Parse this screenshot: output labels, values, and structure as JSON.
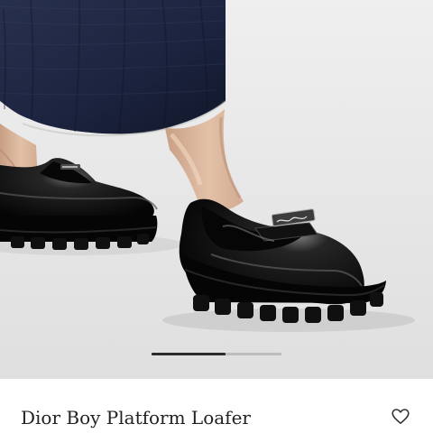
{
  "product": {
    "title": "Dior Boy Platform Loafer",
    "image_icon": "product-photo",
    "wishlist_icon": "heart-outline-icon"
  },
  "gallery": {
    "progress": 0.57
  },
  "colors": {
    "background": "#ffffff",
    "photo_background": "#e8e8e8",
    "denim": "#1f2742",
    "shoe": "#0f0f0f",
    "pager_active": "#2b2b2b",
    "pager_inactive": "#bdbdbd",
    "title": "#222222"
  }
}
